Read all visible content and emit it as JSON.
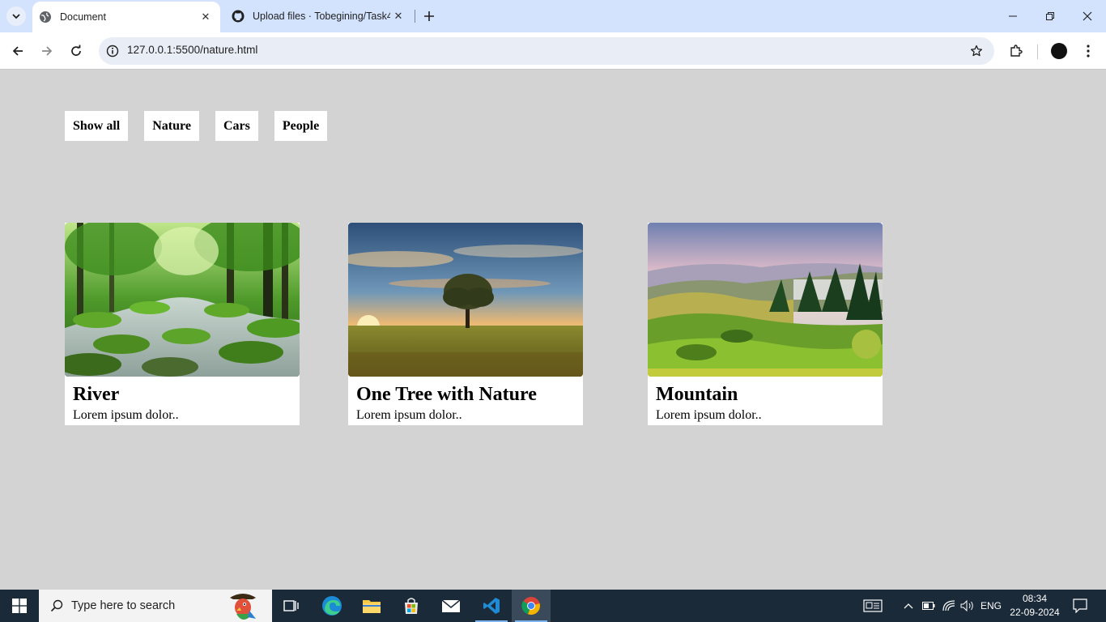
{
  "browser": {
    "tabs": [
      {
        "title": "Document",
        "active": true,
        "icon": "globe-icon"
      },
      {
        "title": "Upload files · Tobegining/Task4",
        "active": false,
        "icon": "github-icon"
      }
    ],
    "url": "127.0.0.1:5500/nature.html"
  },
  "page": {
    "background": "#d3d3d3",
    "filters": [
      {
        "label": "Show all"
      },
      {
        "label": "Nature"
      },
      {
        "label": "Cars"
      },
      {
        "label": "People"
      }
    ],
    "cards": [
      {
        "title": "River",
        "desc": "Lorem ipsum dolor..",
        "image": "forest-stream-image"
      },
      {
        "title": "One Tree with Nature",
        "desc": "Lorem ipsum dolor..",
        "image": "tree-sunset-image"
      },
      {
        "title": "Mountain",
        "desc": "Lorem ipsum dolor..",
        "image": "green-hills-image"
      }
    ]
  },
  "taskbar": {
    "search_placeholder": "Type here to search",
    "language": "ENG",
    "time": "08:34",
    "date": "22-09-2024"
  }
}
